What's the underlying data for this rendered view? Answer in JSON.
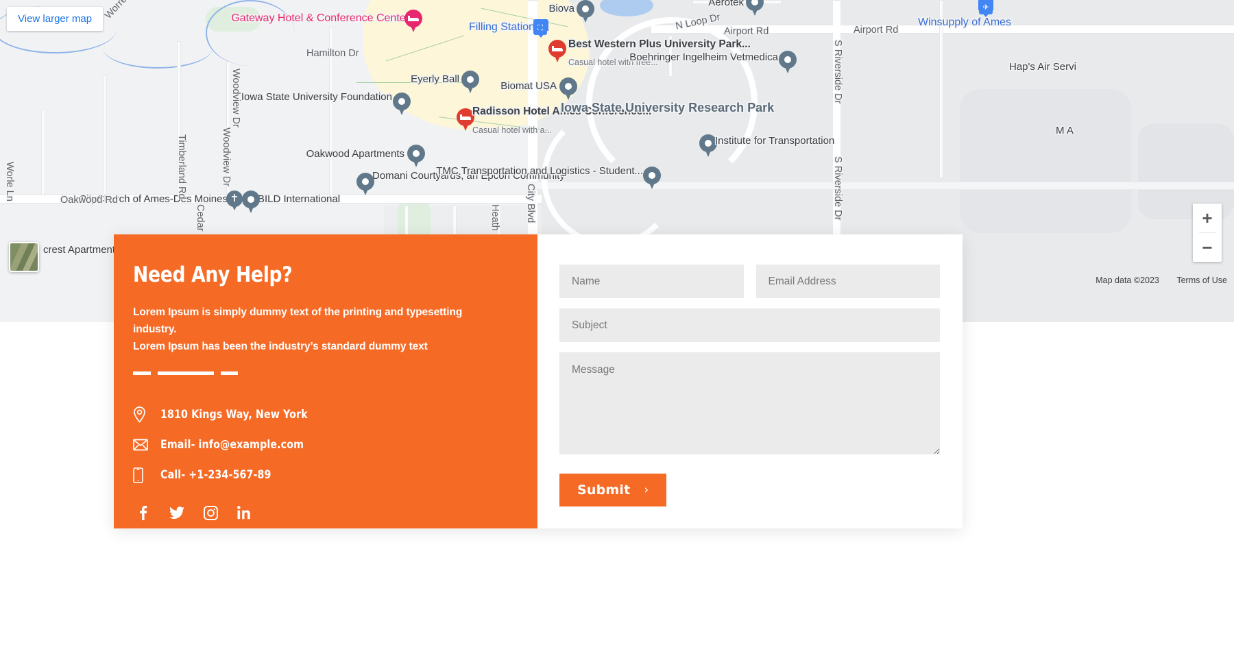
{
  "map": {
    "view_larger_label": "View larger map",
    "zoom_in_label": "+",
    "zoom_out_label": "−",
    "attribution": {
      "map_data": "Map data ©2023",
      "terms": "Terms of Use"
    },
    "area_labels": [
      {
        "text": "Iowa State University Research Park"
      }
    ],
    "pois": [
      {
        "name": "Gateway Hotel & Conference Center",
        "type": "hotel-pink"
      },
      {
        "name": "Filling Station",
        "type": "transit"
      },
      {
        "name": "Best Western Plus University Park...",
        "sub": "Casual hotel with free...",
        "type": "hotel-red"
      },
      {
        "name": "Eyerly Ball",
        "type": "place"
      },
      {
        "name": "Biomat USA",
        "type": "place"
      },
      {
        "name": "Iowa State University Foundation",
        "type": "place"
      },
      {
        "name": "Radisson Hotel Ames Conference...",
        "sub": "Casual hotel with a...",
        "type": "hotel-red"
      },
      {
        "name": "Oakwood Apartments",
        "type": "place"
      },
      {
        "name": "Domani Courtyards, an Epcon Community",
        "type": "place"
      },
      {
        "name": "CityChurch of Ames-Des Moines",
        "type": "church"
      },
      {
        "name": "BILD International",
        "type": "place"
      },
      {
        "name": "Institute for Transportation",
        "type": "place"
      },
      {
        "name": "TMC Transportation and Logistics - Student...",
        "type": "place"
      },
      {
        "name": "Boehringer Ingelheim Vetmedica",
        "type": "place"
      },
      {
        "name": "Biova",
        "type": "place"
      },
      {
        "name": "Aerotek",
        "type": "place"
      },
      {
        "name": "Winsupply of Ames",
        "type": "transit"
      },
      {
        "name": "Hap's Air Servi",
        "type": "place"
      },
      {
        "name": "crest Apartments",
        "type": "place"
      },
      {
        "name": "M A",
        "type": "place"
      }
    ],
    "streets": [
      "Worrell",
      "Hamilton Dr",
      "Woodview Dr",
      "Woodview Dr",
      "Timberland Rd",
      "Worle Ln",
      "Oakwood Rd",
      "Cedar",
      "Heath",
      "City Blvd",
      "N Loop Dr",
      "Airport Rd",
      "Airport Rd",
      "S Riverside Dr",
      "S Riverside Dr"
    ]
  },
  "contact": {
    "heading": "Need Any Help?",
    "intro_line1": "Lorem Ipsum is simply dummy text of the printing and typesetting industry.",
    "intro_line2": "Lorem Ipsum has been the industry’s standard dummy text",
    "address": "1810 Kings Way, New York",
    "email": "Email- info@example.com",
    "phone": "Call- +1-234-567-89",
    "socials": [
      {
        "name": "facebook",
        "glyph": "f"
      },
      {
        "name": "twitter",
        "glyph": "t"
      },
      {
        "name": "instagram",
        "glyph": "i"
      },
      {
        "name": "linkedin",
        "glyph": "in"
      }
    ],
    "accent_color": "#f56a25"
  },
  "form": {
    "name_placeholder": "Name",
    "name_value": "",
    "email_placeholder": "Email Address",
    "email_value": "",
    "subject_placeholder": "Subject",
    "subject_value": "",
    "message_placeholder": "Message",
    "message_value": "",
    "submit_label": "Submit",
    "submit_chevron": "›"
  }
}
